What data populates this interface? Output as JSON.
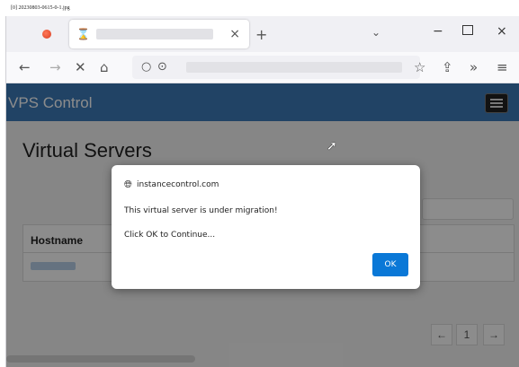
{
  "caption": "[0] 20230803-0615-0-1.jpg",
  "browser": {
    "tab_close": "×",
    "new_tab": "+",
    "tab_list": "⌄",
    "window_minimize": "−",
    "window_close": "×",
    "back": "←",
    "forward": "→",
    "stop": "✕",
    "home": "⌂",
    "bookmark": "☆",
    "share": "⇪",
    "overflow": "»",
    "menu": "≡"
  },
  "app": {
    "brand": "VPS Control",
    "page_title": "Virtual Servers",
    "table_header": "Hostname",
    "pager": [
      "←",
      "1",
      "→"
    ]
  },
  "dialog": {
    "origin": "instancecontrol.com",
    "message_line1": "This virtual server is under migration!",
    "message_line2": "Click OK to Continue...",
    "ok_label": "OK"
  },
  "colors": {
    "app_bar": "#3d7ab8",
    "ok_button": "#0a78d7"
  }
}
